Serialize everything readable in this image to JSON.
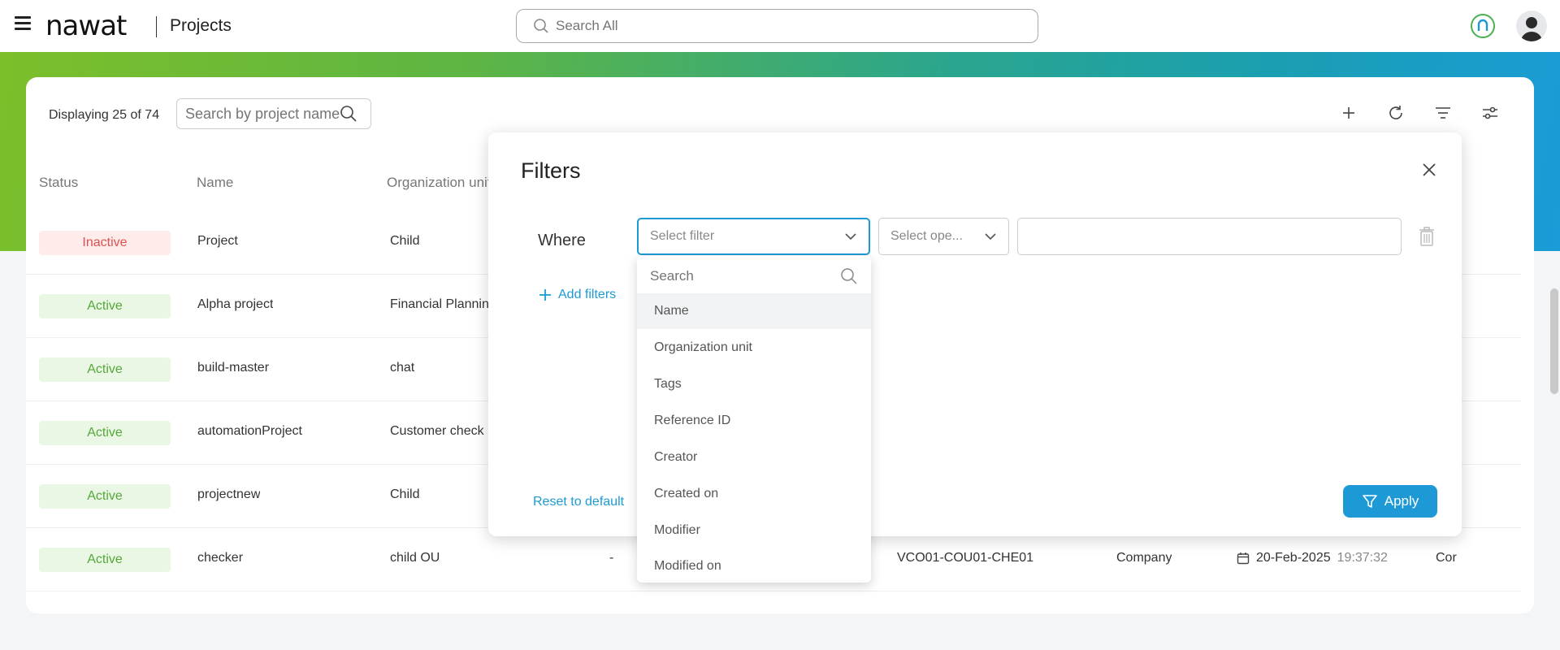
{
  "header": {
    "logo_text": "nawat",
    "app_title": "Projects",
    "search_placeholder": "Search All"
  },
  "card": {
    "display_count": "Displaying 25 of 74",
    "search_placeholder": "Search by project name"
  },
  "table": {
    "columns": [
      "Status",
      "Name",
      "Organization unit"
    ],
    "rows": [
      {
        "status": "Inactive",
        "name": "Project",
        "org": "Child"
      },
      {
        "status": "Active",
        "name": "Alpha project",
        "org": "Financial Planning"
      },
      {
        "status": "Active",
        "name": "build-master",
        "org": "chat"
      },
      {
        "status": "Active",
        "name": "automationProject",
        "org": "Customer check"
      },
      {
        "status": "Active",
        "name": "projectnew",
        "org": "Child"
      },
      {
        "status": "Active",
        "name": "checker",
        "org": "child OU",
        "dash": "-",
        "ref": "VCO01-COU01-CHE01",
        "type": "Company",
        "date": "20-Feb-2025",
        "time": "19:37:32",
        "extra": "Cor"
      }
    ]
  },
  "modal": {
    "title": "Filters",
    "where_label": "Where",
    "select_filter_placeholder": "Select filter",
    "select_operator_placeholder": "Select ope...",
    "add_filters_label": "Add filters",
    "reset_label": "Reset to default",
    "apply_label": "Apply"
  },
  "dropdown": {
    "search_placeholder": "Search",
    "options": [
      "Name",
      "Organization unit",
      "Tags",
      "Reference ID",
      "Creator",
      "Created on",
      "Modifier",
      "Modified on"
    ]
  },
  "colors": {
    "accent": "#1d9ad6",
    "active_text": "#54a83a",
    "inactive_text": "#e05050"
  }
}
